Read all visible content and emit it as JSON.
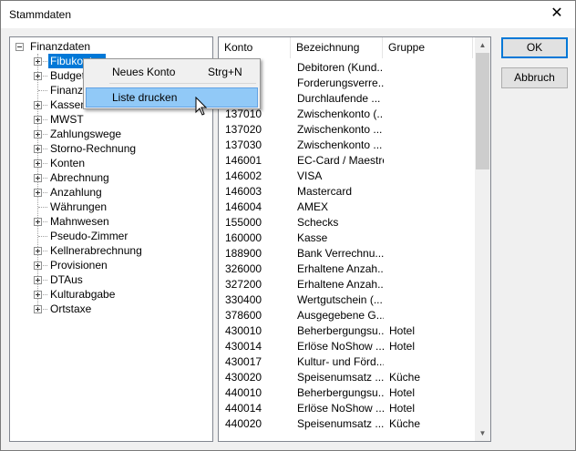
{
  "window": {
    "title": "Stammdaten"
  },
  "icons": {
    "close": "close-icon",
    "cursor": "mouse-pointer-icon"
  },
  "tree": {
    "root": "Finanzdaten",
    "items": [
      {
        "label": "Fibukonten",
        "expandable": true,
        "selected": true
      },
      {
        "label": "Budget",
        "expandable": true
      },
      {
        "label": "Finanz",
        "expandable": false
      },
      {
        "label": "Kassen",
        "expandable": true
      },
      {
        "label": "MWST",
        "expandable": true
      },
      {
        "label": "Zahlungswege",
        "expandable": true
      },
      {
        "label": "Storno-Rechnung",
        "expandable": true
      },
      {
        "label": "Konten",
        "expandable": true
      },
      {
        "label": "Abrechnung",
        "expandable": true
      },
      {
        "label": "Anzahlung",
        "expandable": true
      },
      {
        "label": "Währungen",
        "expandable": false
      },
      {
        "label": "Mahnwesen",
        "expandable": true
      },
      {
        "label": "Pseudo-Zimmer",
        "expandable": false
      },
      {
        "label": "Kellnerabrechnung",
        "expandable": true
      },
      {
        "label": "Provisionen",
        "expandable": true
      },
      {
        "label": "DTAus",
        "expandable": true
      },
      {
        "label": "Kulturabgabe",
        "expandable": true
      },
      {
        "label": "Ortstaxe",
        "expandable": true
      }
    ]
  },
  "list": {
    "columns": [
      "Konto",
      "Bezeichnung",
      "Gruppe"
    ],
    "rows": [
      [
        "",
        "Debitoren (Kund...",
        ""
      ],
      [
        "",
        "Forderungsverre...",
        ""
      ],
      [
        "",
        "Durchlaufende ...",
        ""
      ],
      [
        "137010",
        "Zwischenkonto (...",
        ""
      ],
      [
        "137020",
        "Zwischenkonto ...",
        ""
      ],
      [
        "137030",
        "Zwischenkonto ...",
        ""
      ],
      [
        "146001",
        "EC-Card / Maestro",
        ""
      ],
      [
        "146002",
        "VISA",
        ""
      ],
      [
        "146003",
        "Mastercard",
        ""
      ],
      [
        "146004",
        "AMEX",
        ""
      ],
      [
        "155000",
        "Schecks",
        ""
      ],
      [
        "160000",
        "Kasse",
        ""
      ],
      [
        "188900",
        "Bank Verrechnu...",
        ""
      ],
      [
        "326000",
        "Erhaltene Anzah...",
        ""
      ],
      [
        "327200",
        "Erhaltene Anzah...",
        ""
      ],
      [
        "330400",
        "Wertgutschein (...",
        ""
      ],
      [
        "378600",
        "Ausgegebene G...",
        ""
      ],
      [
        "430010",
        "Beherbergungsu...",
        "Hotel"
      ],
      [
        "430014",
        "Erlöse NoShow ...",
        "Hotel"
      ],
      [
        "430017",
        "Kultur- und Förd...",
        ""
      ],
      [
        "430020",
        "Speisenumsatz ...",
        "Küche"
      ],
      [
        "440010",
        "Beherbergungsu...",
        "Hotel"
      ],
      [
        "440014",
        "Erlöse NoShow ...",
        "Hotel"
      ],
      [
        "440020",
        "Speisenumsatz ...",
        "Küche"
      ]
    ]
  },
  "buttons": {
    "ok": "OK",
    "cancel": "Abbruch"
  },
  "context_menu": {
    "items": [
      {
        "label": "Neues Konto",
        "shortcut": "Strg+N"
      },
      {
        "label": "Liste drucken",
        "shortcut": ""
      }
    ]
  }
}
